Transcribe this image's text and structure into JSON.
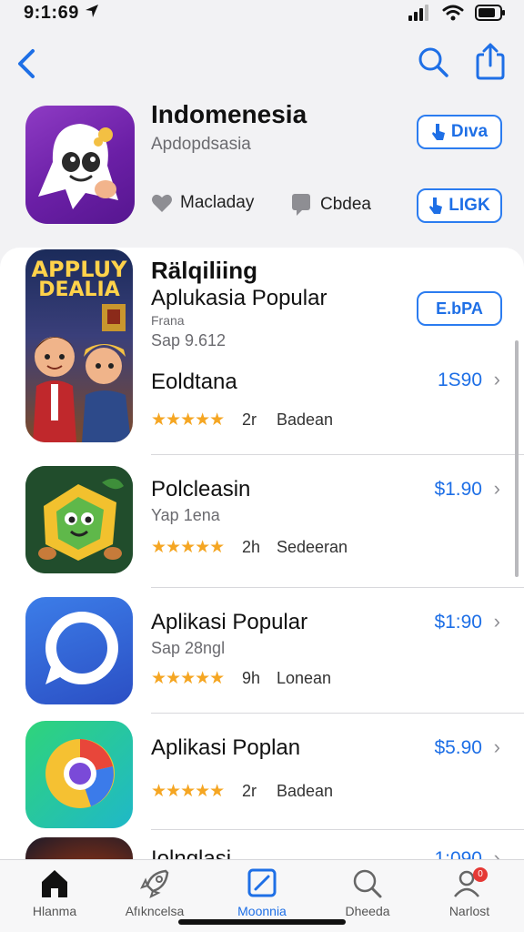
{
  "status": {
    "time": "9:1:69"
  },
  "header": {
    "app_title": "Indomenesia",
    "app_subtitle": "Apdopdsasia",
    "meta_left": "Macladay",
    "meta_right": "Cbdea",
    "button_primary": "Dıva",
    "button_secondary": "LIGK"
  },
  "list": {
    "featured": {
      "icon_art_text_top": "APPLUY",
      "icon_art_text_bottom": "DEALIA",
      "title": "Rälqiliing",
      "subtitle": "Aplukasia Popular",
      "small_line": "Frana",
      "size": "Sap 9.612",
      "secondary_title": "Eoldtana",
      "get_button": "E.bPA",
      "price": "1S90",
      "stars": "★★★★★",
      "rating_count": "2r",
      "rating_label": "Badean"
    },
    "items": [
      {
        "title": "Polcleasin",
        "subtitle": "Yap 1ena",
        "price": "$1.90",
        "stars": "★★★★★",
        "rating_count": "2h",
        "rating_label": "Sedeeran"
      },
      {
        "title": "Aplikasi Popular",
        "subtitle": "Sap 28ngl",
        "price": "$1:90",
        "stars": "★★★★★",
        "rating_count": "9h",
        "rating_label": "Lonean"
      },
      {
        "title": "Aplikasi Poplan",
        "subtitle": "",
        "price": "$5.90",
        "stars": "★★★★★",
        "rating_count": "2r",
        "rating_label": "Badean"
      },
      {
        "title": "Iolnglasi",
        "subtitle": "",
        "price": "1:090",
        "stars": "",
        "rating_count": "",
        "rating_label": ""
      }
    ]
  },
  "tabs": [
    {
      "label": "Hlanma",
      "icon": "home-icon"
    },
    {
      "label": "Afıkncelsa",
      "icon": "rocket-icon"
    },
    {
      "label": "Moonnia",
      "icon": "apps-icon"
    },
    {
      "label": "Dheeda",
      "icon": "search-icon"
    },
    {
      "label": "Narlost",
      "icon": "profile-icon",
      "badge": "0"
    }
  ],
  "colors": {
    "accent": "#1e6fe6",
    "star": "#f5a623",
    "hero_icon": "#7a2bb8"
  }
}
